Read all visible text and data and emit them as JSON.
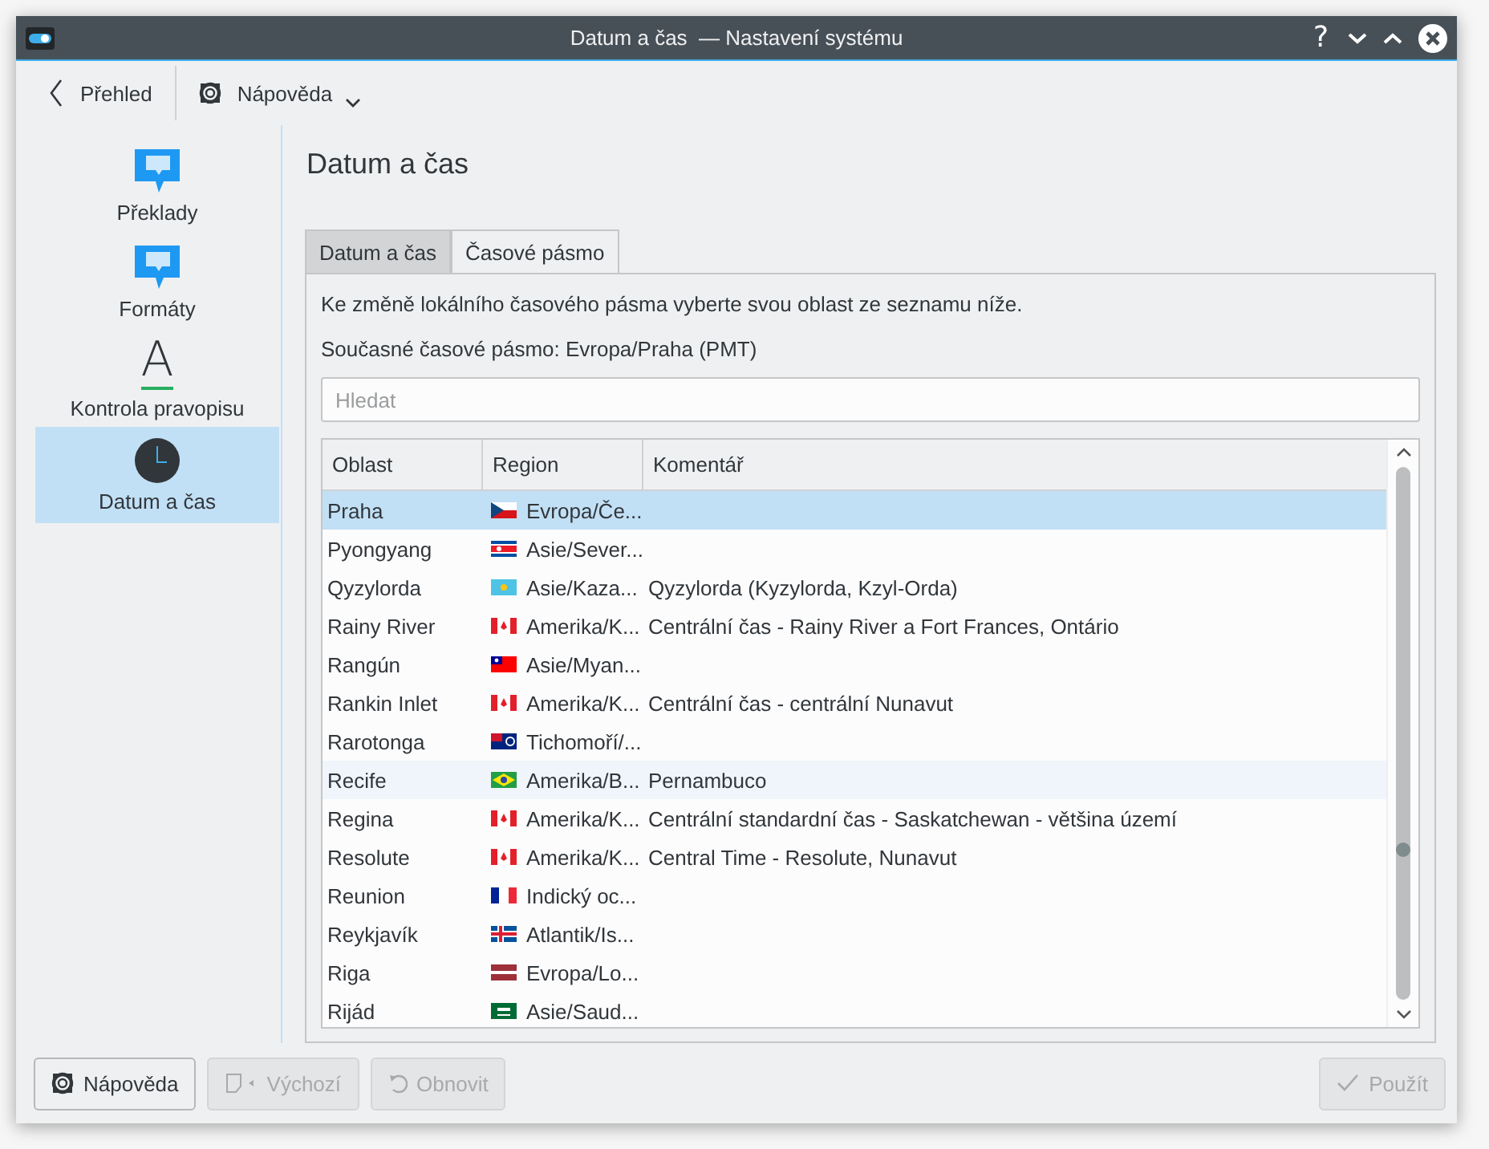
{
  "window": {
    "title": "Datum a čas  — Nastavení systému",
    "buttons": [
      "?"
    ]
  },
  "toolbar": {
    "back": "Přehled",
    "help": "Nápověda"
  },
  "sidebar": {
    "items": [
      {
        "label": "Překlady",
        "kind": "bubble",
        "selected": false
      },
      {
        "label": "Formáty",
        "kind": "bubble",
        "selected": false
      },
      {
        "label": "Kontrola pravopisu",
        "kind": "letter",
        "glyph": "A",
        "selected": false
      },
      {
        "label": "Datum a čas",
        "kind": "clock",
        "selected": true
      }
    ]
  },
  "page": {
    "title": "Datum a čas",
    "tabs": [
      {
        "label": "Datum a čas",
        "selected": false
      },
      {
        "label": "Časové pásmo",
        "selected": true
      }
    ],
    "intro": "Ke změně lokálního časového pásma vyberte svou oblast ze seznamu níže.",
    "current": "Současné časové pásmo: Evropa/Praha (PMT)",
    "search": {
      "placeholder": "Hledat"
    },
    "table": {
      "columns": [
        "Oblast",
        "Region",
        "Komentář"
      ],
      "rows": [
        {
          "area": "Praha",
          "region": "Evropa/Če...",
          "comment": "",
          "selected": true,
          "hovered": false
        },
        {
          "area": "Pyongyang",
          "region": "Asie/Sever...",
          "comment": "",
          "selected": false,
          "hovered": false
        },
        {
          "area": "Qyzylorda",
          "region": "Asie/Kaza...",
          "comment": "Qyzylorda (Kyzylorda, Kzyl-Orda)",
          "selected": false,
          "hovered": false
        },
        {
          "area": "Rainy River",
          "region": "Amerika/K...",
          "comment": "Centrální čas - Rainy River a Fort Frances, Ontário",
          "selected": false,
          "hovered": false
        },
        {
          "area": "Rangún",
          "region": "Asie/Myan...",
          "comment": "",
          "selected": false,
          "hovered": false
        },
        {
          "area": "Rankin Inlet",
          "region": "Amerika/K...",
          "comment": "Centrální čas - centrální Nunavut",
          "selected": false,
          "hovered": false
        },
        {
          "area": "Rarotonga",
          "region": "Tichomoří/...",
          "comment": "",
          "selected": false,
          "hovered": false
        },
        {
          "area": "Recife",
          "region": "Amerika/B...",
          "comment": "Pernambuco",
          "selected": false,
          "hovered": true
        },
        {
          "area": "Regina",
          "region": "Amerika/K...",
          "comment": "Centrální standardní čas - Saskatchewan - většina území",
          "selected": false,
          "hovered": false
        },
        {
          "area": "Resolute",
          "region": "Amerika/K...",
          "comment": "Central Time - Resolute, Nunavut",
          "selected": false,
          "hovered": false
        },
        {
          "area": "Reunion",
          "region": "Indický oc...",
          "comment": "",
          "selected": false,
          "hovered": false
        },
        {
          "area": "Reykjavík",
          "region": "Atlantik/Is...",
          "comment": "",
          "selected": false,
          "hovered": false
        },
        {
          "area": "Riga",
          "region": "Evropa/Lo...",
          "comment": "",
          "selected": false,
          "hovered": false
        },
        {
          "area": "Rijád",
          "region": "Asie/Saud...",
          "comment": "",
          "selected": false,
          "hovered": false
        }
      ]
    }
  },
  "footer": {
    "buttons": [
      {
        "label": "Nápověda",
        "kind": "help",
        "disabled": false
      },
      {
        "label": "Výchozí",
        "kind": "defaults",
        "disabled": true
      },
      {
        "label": "Obnovit",
        "kind": "reset",
        "disabled": true
      },
      {
        "label": "Použít",
        "kind": "apply",
        "disabled": true
      }
    ]
  }
}
